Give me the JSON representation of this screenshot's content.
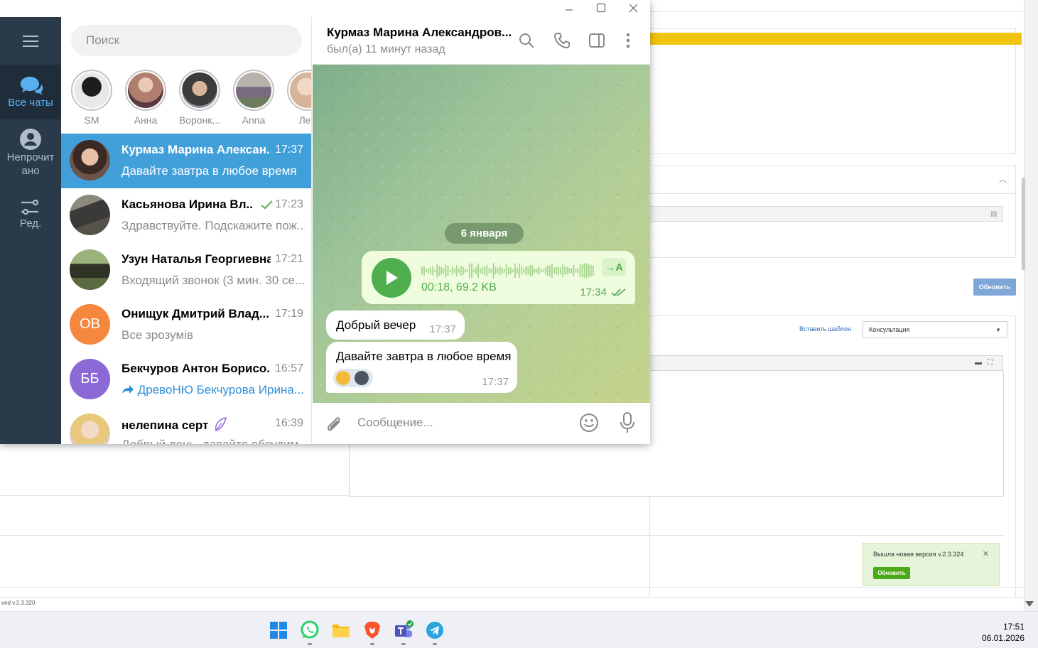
{
  "background_app": {
    "update_button": "Обновить",
    "insert_template_link": "Вставить шаблон",
    "consult_select_value": "Консультация",
    "notice_text": "Вышла новая версия v.2.3.324",
    "notice_button": "Обновить",
    "footer_version": "ved v.2.3.320"
  },
  "telegram": {
    "rail": {
      "all_chats": "Все чаты",
      "unread": "Непрочит\nано",
      "edit": "Ред."
    },
    "search_placeholder": "Поиск",
    "stories": [
      {
        "name": "SM",
        "color": "#4a4a4a"
      },
      {
        "name": "Анна",
        "color": "#b07e6e"
      },
      {
        "name": "Воронк...",
        "color": "#6b6f73"
      },
      {
        "name": "Anna",
        "color": "#7a6a7e"
      },
      {
        "name": "Лер",
        "color": "#d7b39a"
      }
    ],
    "chats": [
      {
        "name": "Курмаз Марина Алексан...",
        "time": "17:37",
        "last": "Давайте завтра в любое время",
        "avatar_color": "#6d5448",
        "initials": ""
      },
      {
        "name": "Касьянова Ирина Вл...",
        "time": "17:23",
        "last": "Здравствуйте. Подскажите пож...",
        "avatar_color": "#55524a",
        "initials": ""
      },
      {
        "name": "Узун Наталья Георгиевна",
        "time": "17:21",
        "last": "Входящий звонок (3 мин. 30 се...",
        "avatar_color": "#5a6b42",
        "initials": ""
      },
      {
        "name": "Онищук Дмитрий Влад...",
        "time": "17:19",
        "last": "Все зрозумів",
        "avatar_color": "#f5883e",
        "initials": "ОВ"
      },
      {
        "name": "Бекчуров Антон Борисо...",
        "time": "16:57",
        "last": "ДревоНЮ Бекчурова Ирина...",
        "avatar_color": "#8b6ad8",
        "initials": "ББ"
      },
      {
        "name": "нелепина серт",
        "time": "16:39",
        "last": "Добрый день, давайте обсудим",
        "avatar_color": "#e2cbbc",
        "initials": ""
      }
    ],
    "header": {
      "title": "Курмаз Марина Александров...",
      "status": "был(а) 11 минут назад"
    },
    "date_divider": "6 января",
    "voice": {
      "meta": "00:18, 69.2 KB",
      "time": "17:34",
      "transcribe": "→A"
    },
    "messages": [
      {
        "text": "Добрый вечер",
        "time": "17:37"
      },
      {
        "text": "Давайте завтра в любое время",
        "time": "17:37"
      }
    ],
    "input_placeholder": "Сообщение..."
  },
  "taskbar": {
    "time": "17:51",
    "date": "06.01.2026"
  }
}
